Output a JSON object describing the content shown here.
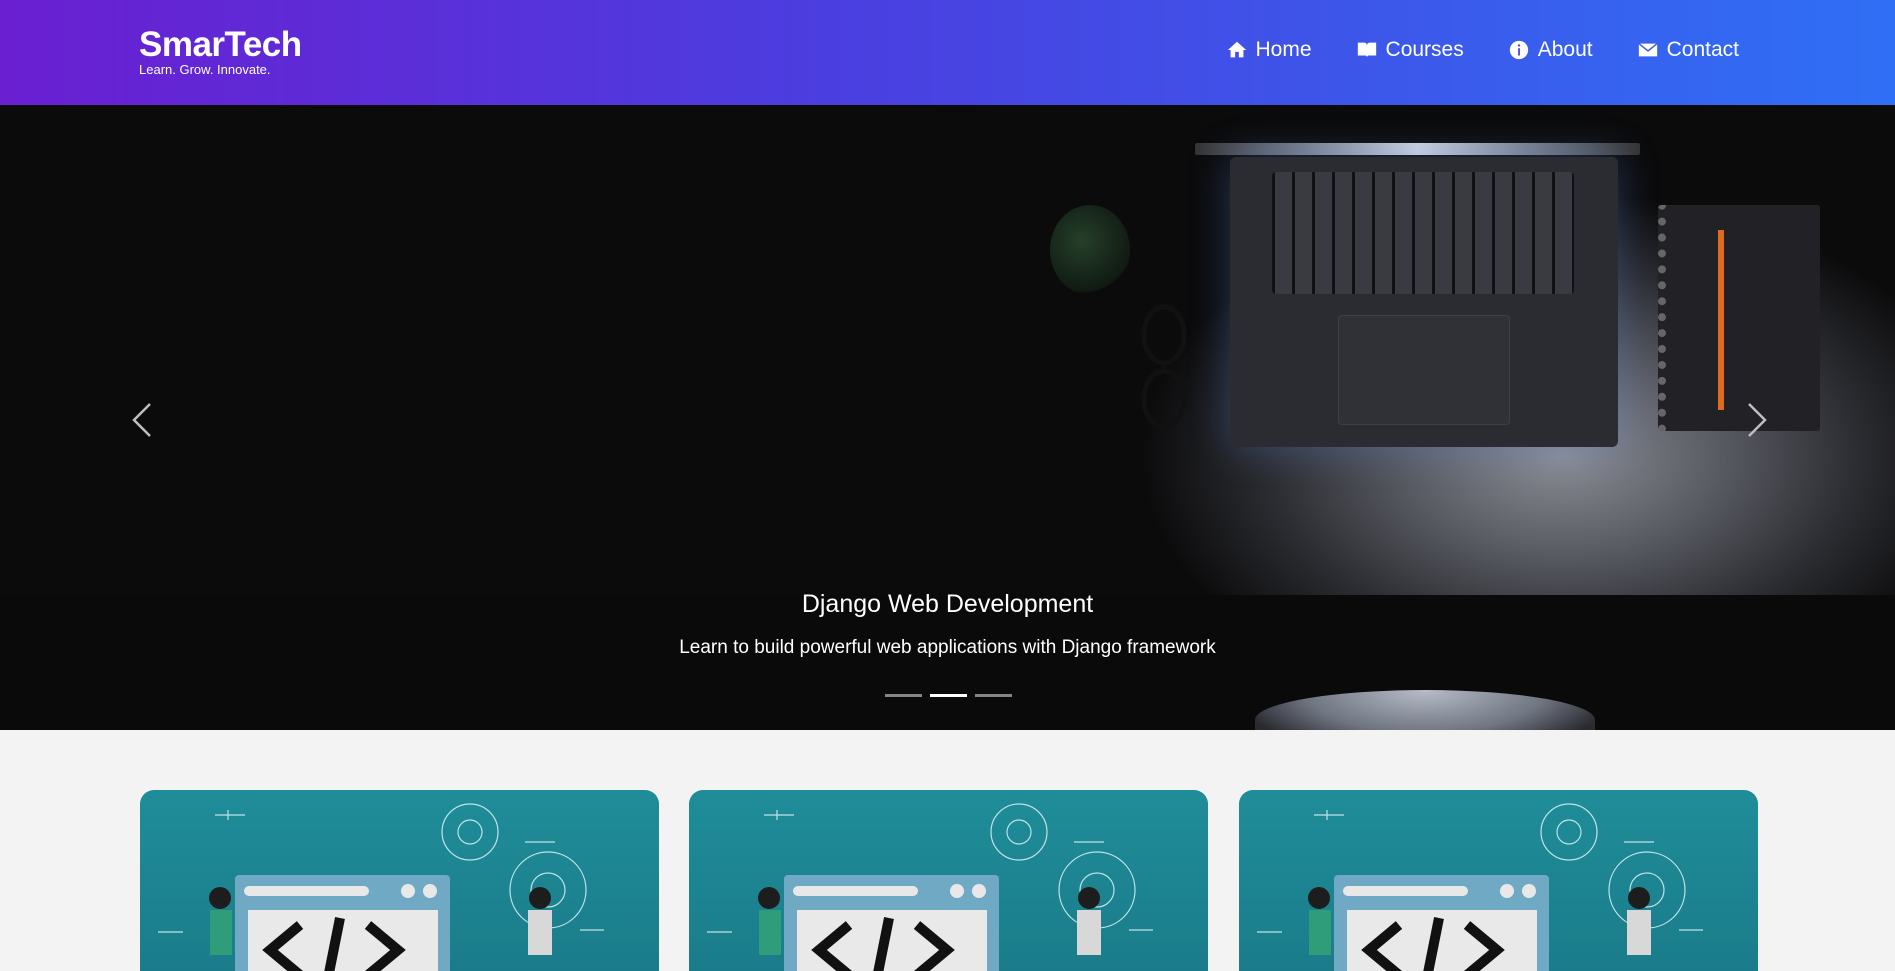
{
  "header": {
    "brand": "SmarTech",
    "tagline": "Learn. Grow. Innovate.",
    "nav": [
      {
        "label": "Home",
        "icon": "home-icon"
      },
      {
        "label": "Courses",
        "icon": "book-icon"
      },
      {
        "label": "About",
        "icon": "info-icon"
      },
      {
        "label": "Contact",
        "icon": "envelope-icon"
      }
    ]
  },
  "carousel": {
    "title": "Django Web Development",
    "text": "Learn to build powerful web applications with Django framework",
    "slide_count": 3,
    "active_index": 1
  },
  "courses": {
    "card_count": 3
  },
  "colors": {
    "header_gradient_start": "#6a1fd1",
    "header_gradient_end": "#2f6ff5",
    "card_teal": "#1f8d99"
  }
}
